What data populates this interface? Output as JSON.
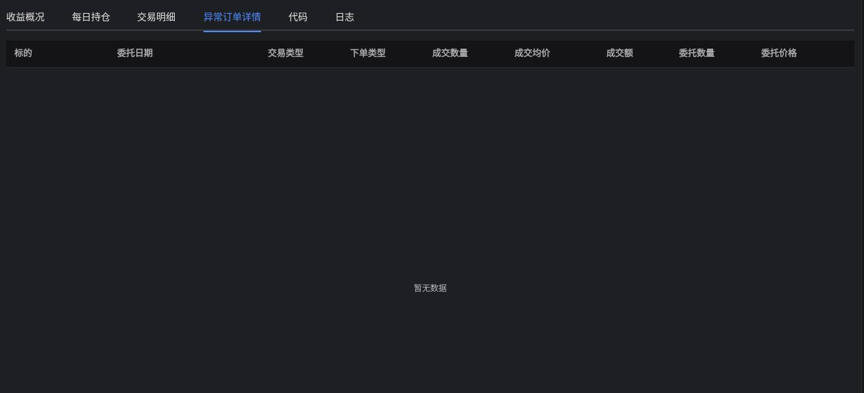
{
  "tabs": [
    {
      "label": "收益概况",
      "active": false
    },
    {
      "label": "每日持仓",
      "active": false
    },
    {
      "label": "交易明细",
      "active": false
    },
    {
      "label": "异常订单详情",
      "active": true
    },
    {
      "label": "代码",
      "active": false
    },
    {
      "label": "日志",
      "active": false
    }
  ],
  "table": {
    "headers": [
      "标的",
      "委托日期",
      "交易类型",
      "下单类型",
      "成交数量",
      "成交均价",
      "成交额",
      "委托数量",
      "委托价格"
    ],
    "rows": [],
    "empty_text": "暂无数据"
  },
  "colors": {
    "background": "#1e1f22",
    "header_bg": "#141416",
    "accent": "#4c8dff",
    "text": "#e6e6e6",
    "header_text": "#a9abb0"
  }
}
